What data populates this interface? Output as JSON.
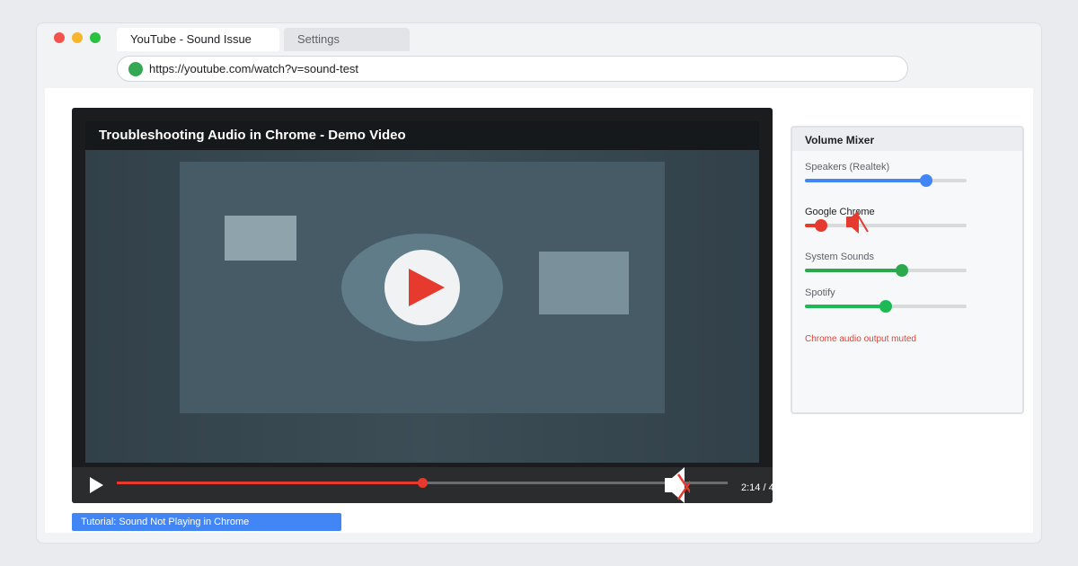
{
  "browser": {
    "tabs": [
      {
        "label": "YouTube - Sound Issue",
        "active": true
      },
      {
        "label": "Settings",
        "active": false
      }
    ],
    "url": "https://youtube.com/watch?v=sound-test"
  },
  "player": {
    "title": "Troubleshooting Audio in Chrome - Demo Video",
    "progress": 0.5,
    "time": "2:14 / 4",
    "muted": true,
    "play_icon": "play-icon",
    "mute_icon": "speaker-muted-icon"
  },
  "tutorial_bar": {
    "label": "Tutorial: Sound Not Playing in Chrome"
  },
  "mixer": {
    "title": "Volume Mixer",
    "channels": [
      {
        "label": "Speakers (Realtek)",
        "level": 0.75,
        "color": "#4285f4"
      },
      {
        "label": "Google Chrome",
        "level": 0.1,
        "color": "#e53a2d",
        "muted": true
      },
      {
        "label": "System Sounds",
        "level": 0.6,
        "color": "#2ca94c"
      },
      {
        "label": "Spotify",
        "level": 0.5,
        "color": "#1db954"
      }
    ],
    "status": "Chrome audio output muted"
  },
  "colors": {
    "accent": "#e53a2d",
    "link": "#4285f4",
    "secure": "#34a853"
  }
}
